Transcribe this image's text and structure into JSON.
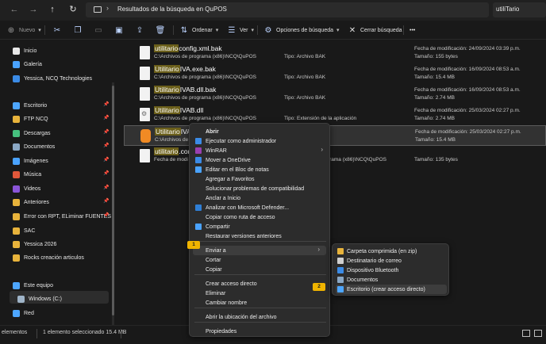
{
  "address_bar": {
    "path": "Resultados de la búsqueda en QuPOS",
    "search_value": "utiliTario",
    "nav": {
      "back": "←",
      "forward": "→",
      "up": "↑",
      "refresh": "↻",
      "chevron": "›"
    }
  },
  "toolbar": {
    "new_label": "Nuevo",
    "sort_label": "Ordenar",
    "view_label": "Ver",
    "search_options_label": "Opciones de búsqueda",
    "close_search_label": "Cerrar búsqueda",
    "more_label": "•••"
  },
  "sidebar": {
    "items": [
      {
        "label": "Inicio",
        "icon": "home-icon",
        "color": "#e8e8e8",
        "pinned": false
      },
      {
        "label": "Galería",
        "icon": "gallery-icon",
        "color": "#4aa3ff",
        "pinned": false
      },
      {
        "label": "Yessica, NCQ Technologies",
        "icon": "onedrive-icon",
        "color": "#3b8be6",
        "pinned": false
      },
      {
        "label": "Escritorio",
        "icon": "desktop-icon",
        "color": "#4da6ff",
        "pinned": true
      },
      {
        "label": "FTP NCQ",
        "icon": "folder-icon",
        "color": "#e8b33b",
        "pinned": true
      },
      {
        "label": "Descargas",
        "icon": "download-icon",
        "color": "#46c07e",
        "pinned": true
      },
      {
        "label": "Documentos",
        "icon": "documents-icon",
        "color": "#8aa7c4",
        "pinned": true
      },
      {
        "label": "Imágenes",
        "icon": "pictures-icon",
        "color": "#4aa3ff",
        "pinned": true
      },
      {
        "label": "Música",
        "icon": "music-icon",
        "color": "#e0573a",
        "pinned": true
      },
      {
        "label": "Videos",
        "icon": "videos-icon",
        "color": "#8a55d8",
        "pinned": true
      },
      {
        "label": "Anteriores",
        "icon": "folder-icon",
        "color": "#e8b33b",
        "pinned": true
      },
      {
        "label": "Error con RPT, ELiminar FUENTES",
        "icon": "folder-icon",
        "color": "#e8b33b",
        "pinned": true
      },
      {
        "label": "SAC",
        "icon": "folder-icon",
        "color": "#e8b33b",
        "pinned": false
      },
      {
        "label": "Yessica 2026",
        "icon": "folder-icon",
        "color": "#e8b33b",
        "pinned": false
      },
      {
        "label": "Rocks creación articulos",
        "icon": "folder-icon",
        "color": "#e8b33b",
        "pinned": false
      },
      {
        "label": "Este equipo",
        "icon": "pc-icon",
        "color": "#4da6ff",
        "pinned": false
      },
      {
        "label": "Windows  (C:)",
        "icon": "drive-icon",
        "color": "#9fb4c8",
        "pinned": false
      },
      {
        "label": "Red",
        "icon": "network-icon",
        "color": "#4da6ff",
        "pinned": false
      }
    ]
  },
  "files": [
    {
      "prefix": "utilitario",
      "rest": "config.xml.bak",
      "path": "C:\\Archivos de programa (x86)\\NCQ\\QuPOS",
      "type": "Tipo: Archivo BAK",
      "date": "Fecha de modificación: 24/09/2024 03:39 p.m.",
      "size": "Tamaño: 155 bytes",
      "icon": "file-icon"
    },
    {
      "prefix": "Utilitario",
      "rest": "IVA.exe.bak",
      "path": "C:\\Archivos de programa (x86)\\NCQ\\QuPOS",
      "type": "Tipo: Archivo BAK",
      "date": "Fecha de modificación: 16/09/2024 08:53 a.m.",
      "size": "Tamaño: 15.4 MB",
      "icon": "file-icon"
    },
    {
      "prefix": "Utilitario",
      "rest": "IVAB.dll.bak",
      "path": "C:\\Archivos de programa (x86)\\NCQ\\QuPOS",
      "type": "Tipo: Archivo BAK",
      "date": "Fecha de modificación: 16/09/2024 08:53 a.m.",
      "size": "Tamaño: 2.74 MB",
      "icon": "file-icon"
    },
    {
      "prefix": "Utilitario",
      "rest": "IVAB.dll",
      "path": "C:\\Archivos de programa (x86)\\NCQ\\QuPOS",
      "type": "Tipo: Extensión de la aplicación",
      "date": "Fecha de modificación: 25/03/2024 02:27 p.m.",
      "size": "Tamaño: 2.74 MB",
      "icon": "dll-icon"
    },
    {
      "prefix": "Utilitario",
      "rest": "IVA",
      "path": "C:\\Archivos de pr",
      "type": "",
      "date": "Fecha de modificación: 25/03/2024 02:27 p.m.",
      "size": "Tamaño: 15.4 MB",
      "icon": "app-icon"
    },
    {
      "prefix": "utilitario",
      "rest": ".con",
      "path": "Fecha de modi",
      "type": "C:\\Archivos de programa (x86)\\NCQ\\QuPOS",
      "date": "",
      "size": "Tamaño: 135 bytes",
      "icon": "file-icon"
    }
  ],
  "status_bar": {
    "items_text": "elementos",
    "selected_text": "1 elemento seleccionado  15.4 MB"
  },
  "context_menu": {
    "items": [
      {
        "label": "Abrir",
        "bold": true,
        "icon": ""
      },
      {
        "label": "Ejecutar como administrador",
        "icon": "shield-icon",
        "color": "#3b8be6"
      },
      {
        "label": "WinRAR",
        "icon": "winrar-icon",
        "color": "#9a3fb0",
        "submenu": true
      },
      {
        "label": "Mover a OneDrive",
        "icon": "onedrive-icon",
        "color": "#3b8be6"
      },
      {
        "label": "Editar en el Bloc de notas",
        "icon": "notepad-icon",
        "color": "#4aa3ff"
      },
      {
        "label": "Agregar a Favoritos",
        "icon": ""
      },
      {
        "label": "Solucionar problemas de compatibilidad",
        "icon": ""
      },
      {
        "label": "Anclar a Inicio",
        "icon": ""
      },
      {
        "label": "Analizar con Microsoft Defender...",
        "icon": "defender-icon",
        "color": "#2f7fd6"
      },
      {
        "label": "Copiar como ruta de acceso",
        "icon": ""
      },
      {
        "label": "Compartir",
        "icon": "share-icon",
        "color": "#4aa3ff"
      },
      {
        "label": "Restaurar versiones anteriores",
        "icon": ""
      },
      {
        "label": "Enviar a",
        "icon": "",
        "submenu": true,
        "hover": true
      },
      {
        "label": "Cortar",
        "icon": ""
      },
      {
        "label": "Copiar",
        "icon": ""
      },
      {
        "label": "Crear acceso directo",
        "icon": ""
      },
      {
        "label": "Eliminar",
        "icon": ""
      },
      {
        "label": "Cambiar nombre",
        "icon": ""
      },
      {
        "label": "Abrir la ubicación del archivo",
        "icon": ""
      },
      {
        "label": "Propiedades",
        "icon": ""
      }
    ]
  },
  "send_to_menu": {
    "items": [
      {
        "label": "Carpeta comprimida (en zip)",
        "icon": "zip-folder-icon",
        "color": "#e8b33b"
      },
      {
        "label": "Destinatario de correo",
        "icon": "mail-icon",
        "color": "#cfcfcf"
      },
      {
        "label": "Dispositivo Bluetooth",
        "icon": "bluetooth-icon",
        "color": "#3b8be6"
      },
      {
        "label": "Documentos",
        "icon": "documents-icon",
        "color": "#8aa7c4"
      },
      {
        "label": "Escritorio (crear acceso directo)",
        "icon": "desktop-icon",
        "color": "#4da6ff",
        "hover": true
      }
    ]
  },
  "callouts": {
    "one": "1",
    "two": "2"
  }
}
